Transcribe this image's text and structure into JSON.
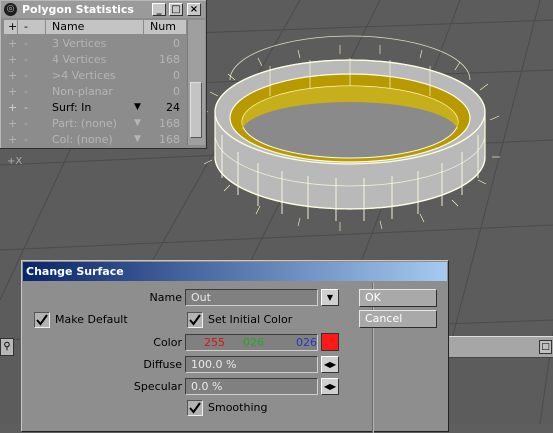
{
  "polygon_stats": {
    "title": "Polygon Statistics",
    "header": {
      "plus": "+",
      "minus": "-",
      "name": "Name",
      "num": "Num"
    },
    "rows": [
      {
        "plus": "+",
        "minus": "-",
        "name": "3 Vertices",
        "num": "0"
      },
      {
        "plus": "+",
        "minus": "-",
        "name": "4 Vertices",
        "num": "168"
      },
      {
        "plus": "+",
        "minus": "-",
        "name": ">4 Vertices",
        "num": "0"
      },
      {
        "plus": "+",
        "minus": "-",
        "name": "Non-planar",
        "num": "0"
      },
      {
        "plus": "+",
        "minus": "-",
        "name": "Surf: In",
        "num": "24"
      },
      {
        "plus": "+",
        "minus": "-",
        "name": "Part: (none)",
        "num": "168"
      },
      {
        "plus": "+",
        "minus": "-",
        "name": "Col: (none)",
        "num": "168"
      }
    ]
  },
  "viewport": {
    "axis_label": "+X"
  },
  "change_surface": {
    "title": "Change Surface",
    "name_label": "Name",
    "name_value": "Out",
    "make_default_label": "Make Default",
    "make_default_checked": true,
    "set_initial_color_label": "Set Initial Color",
    "set_initial_color_checked": true,
    "color_label": "Color",
    "color_r": "255",
    "color_g": "026",
    "color_b": "026",
    "color_swatch": "#ff1a1a",
    "diffuse_label": "Diffuse",
    "diffuse_value": "100.0 %",
    "specular_label": "Specular",
    "specular_value": "0.0 %",
    "smoothing_label": "Smoothing",
    "smoothing_checked": true,
    "ok_label": "OK",
    "cancel_label": "Cancel"
  },
  "colors": {
    "ring_fill": "#c8a800",
    "wire": "#ffffcc",
    "title_bar": "#0a246a"
  },
  "icons": {
    "name_dropdown": "triangle-down-icon",
    "spin": "left-right-arrows-icon"
  }
}
